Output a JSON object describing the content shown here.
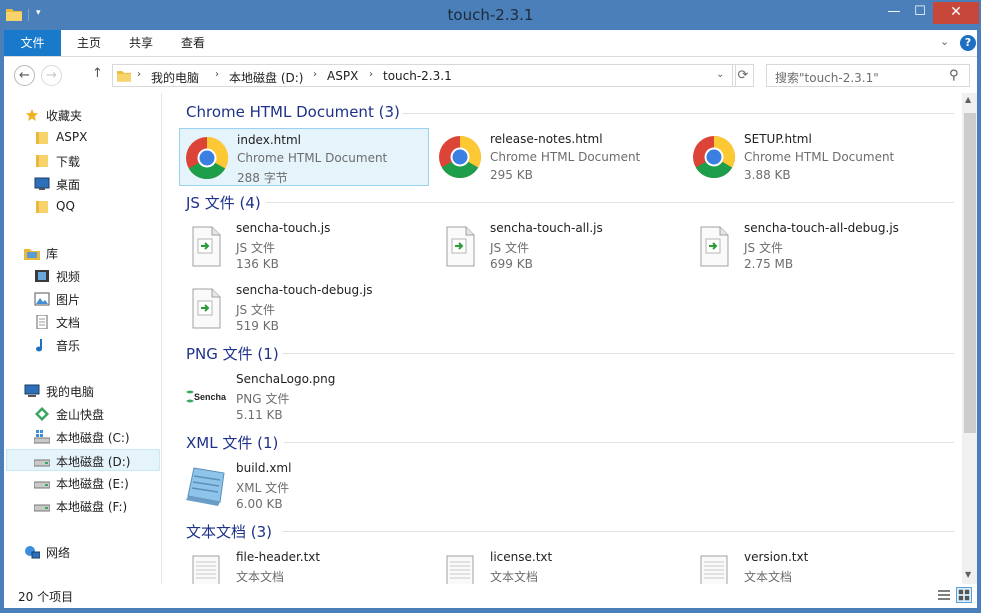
{
  "window": {
    "title": "touch-2.3.1"
  },
  "titlebar": {
    "min_glyph": "—",
    "max_glyph": "☐",
    "close_glyph": "✕",
    "qa_drop_glyph": "▾"
  },
  "ribbon": {
    "tabs": [
      "文件",
      "主页",
      "共享",
      "查看"
    ],
    "expand_glyph": "⌄",
    "help_glyph": "?"
  },
  "nav": {
    "back_glyph": "←",
    "forward_glyph": "→",
    "up_glyph": "↑",
    "refresh_glyph": "⟳",
    "breadcrumb": [
      "我的电脑",
      "本地磁盘 (D:)",
      "ASPX",
      "touch-2.3.1"
    ],
    "crumb_sep": "›",
    "addr_drop_glyph": "⌄",
    "search_placeholder": "搜索\"touch-2.3.1\"",
    "search_glyph": "⚲"
  },
  "sidebar": {
    "items": [
      {
        "label": "收藏夹",
        "icon": "star-icon"
      },
      {
        "label": "ASPX",
        "icon": "folder-icon"
      },
      {
        "label": "下载",
        "icon": "folder-icon"
      },
      {
        "label": "桌面",
        "icon": "desktop-icon"
      },
      {
        "label": "QQ",
        "icon": "folder-icon"
      },
      {
        "label": "库",
        "icon": "library-icon"
      },
      {
        "label": "视频",
        "icon": "video-icon"
      },
      {
        "label": "图片",
        "icon": "picture-icon"
      },
      {
        "label": "文档",
        "icon": "document-icon"
      },
      {
        "label": "音乐",
        "icon": "music-icon"
      },
      {
        "label": "我的电脑",
        "icon": "computer-icon"
      },
      {
        "label": "金山快盘",
        "icon": "cloud-drive-icon"
      },
      {
        "label": "本地磁盘 (C:)",
        "icon": "system-drive-icon"
      },
      {
        "label": "本地磁盘 (D:)",
        "icon": "drive-icon",
        "selected": true
      },
      {
        "label": "本地磁盘 (E:)",
        "icon": "drive-icon"
      },
      {
        "label": "本地磁盘 (F:)",
        "icon": "drive-icon"
      },
      {
        "label": "网络",
        "icon": "network-icon"
      }
    ]
  },
  "groups": [
    {
      "title": "Chrome HTML Document (3)",
      "files": [
        {
          "name": "index.html",
          "type": "Chrome HTML Document",
          "size": "288 字节",
          "icon": "chrome-icon",
          "selected": true
        },
        {
          "name": "release-notes.html",
          "type": "Chrome HTML Document",
          "size": "295 KB",
          "icon": "chrome-icon"
        },
        {
          "name": "SETUP.html",
          "type": "Chrome HTML Document",
          "size": "3.88 KB",
          "icon": "chrome-icon"
        }
      ]
    },
    {
      "title": "JS 文件 (4)",
      "files": [
        {
          "name": "sencha-touch.js",
          "type": "JS 文件",
          "size": "136 KB",
          "icon": "js-file-icon"
        },
        {
          "name": "sencha-touch-all.js",
          "type": "JS 文件",
          "size": "699 KB",
          "icon": "js-file-icon"
        },
        {
          "name": "sencha-touch-all-debug.js",
          "type": "JS 文件",
          "size": "2.75 MB",
          "icon": "js-file-icon"
        },
        {
          "name": "sencha-touch-debug.js",
          "type": "JS 文件",
          "size": "519 KB",
          "icon": "js-file-icon"
        }
      ]
    },
    {
      "title": "PNG 文件 (1)",
      "files": [
        {
          "name": "SenchaLogo.png",
          "type": "PNG 文件",
          "size": "5.11 KB",
          "icon": "sencha-logo-icon",
          "logo_text": "Sencha"
        }
      ]
    },
    {
      "title": "XML 文件 (1)",
      "files": [
        {
          "name": "build.xml",
          "type": "XML 文件",
          "size": "6.00 KB",
          "icon": "xml-file-icon"
        }
      ]
    },
    {
      "title": "文本文档 (3)",
      "files": [
        {
          "name": "file-header.txt",
          "type": "文本文档",
          "icon": "text-file-icon"
        },
        {
          "name": "license.txt",
          "type": "文本文档",
          "icon": "text-file-icon"
        },
        {
          "name": "version.txt",
          "type": "文本文档",
          "icon": "text-file-icon"
        }
      ]
    }
  ],
  "scrollbar": {
    "up_glyph": "▲",
    "down_glyph": "▼"
  },
  "status": {
    "count": "20 个项目"
  },
  "colors": {
    "accent": "#1979ca",
    "titlebar": "#4a7fb9",
    "group_header": "#1e3287",
    "selection": "#e5f3fb",
    "close": "#c7473b"
  }
}
